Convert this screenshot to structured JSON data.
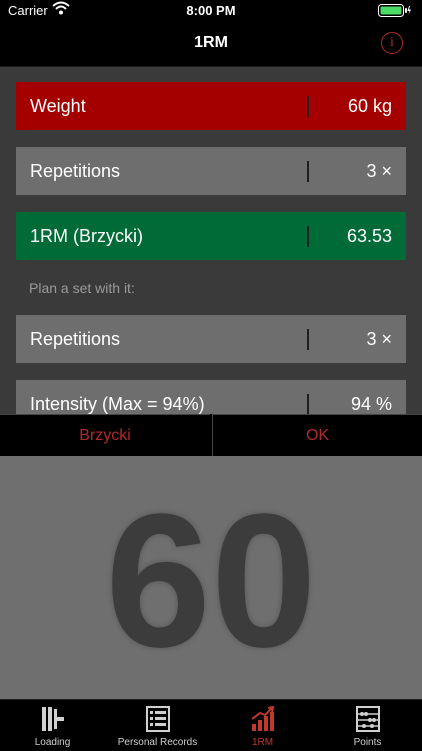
{
  "status": {
    "carrier": "Carrier",
    "time": "8:00 PM"
  },
  "nav": {
    "title": "1RM"
  },
  "rows": {
    "weight": {
      "label": "Weight",
      "value": "60 kg"
    },
    "repetitions": {
      "label": "Repetitions",
      "value": "3 ×"
    },
    "one_rm": {
      "label": "1RM (Brzycki)",
      "value": "63.53"
    },
    "plan_label": "Plan a set with it:",
    "plan_repetitions": {
      "label": "Repetitions",
      "value": "3 ×"
    },
    "intensity": {
      "label": "Intensity (Max = 94%)",
      "value": "94 %"
    }
  },
  "actions": {
    "left": "Brzycki",
    "right": "OK"
  },
  "display": {
    "value": "60"
  },
  "tabs": [
    {
      "label": "Loading",
      "icon": "barbell-plates-icon"
    },
    {
      "label": "Personal Records",
      "icon": "list-icon"
    },
    {
      "label": "1RM",
      "icon": "chart-up-icon"
    },
    {
      "label": "Points",
      "icon": "abacus-icon"
    }
  ],
  "colors": {
    "accent": "#b22a2a",
    "weight_row": "#a50000",
    "one_rm_row": "#006b36",
    "gray_row": "#6e6e6e"
  }
}
